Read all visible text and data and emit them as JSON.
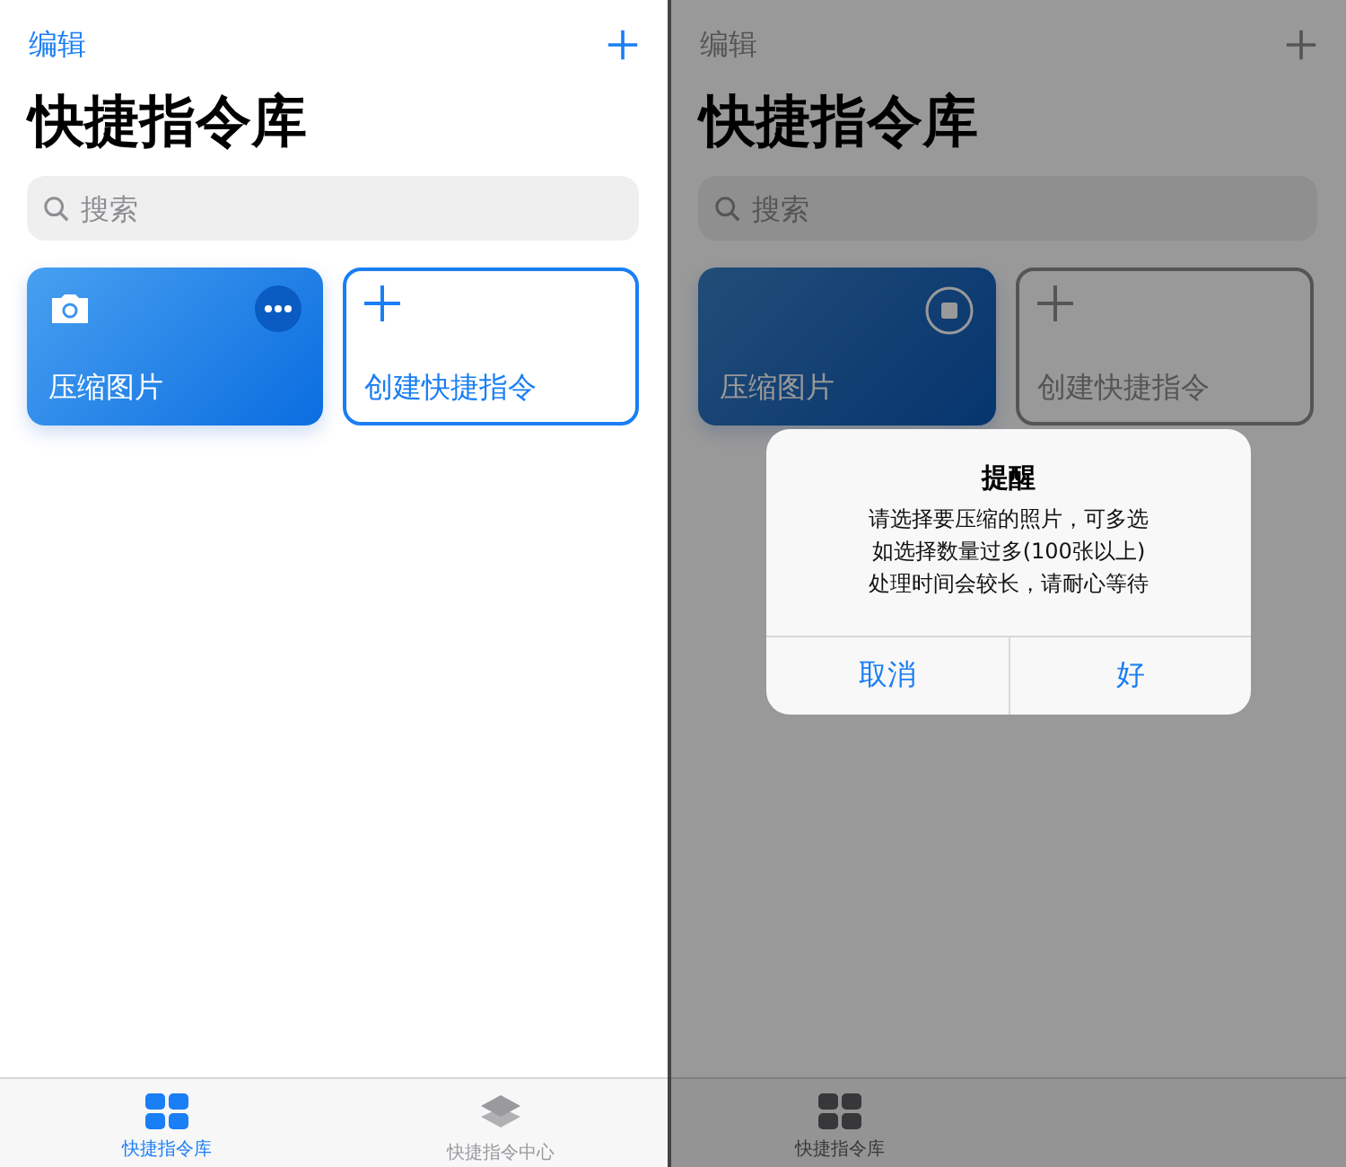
{
  "screens": [
    {
      "edit_label": "编辑",
      "title": "快捷指令库",
      "search": {
        "placeholder": "搜索"
      },
      "dimmed": false,
      "shortcuts": [
        {
          "kind": "shortcut",
          "label": "压缩图片",
          "running": false
        },
        {
          "kind": "create",
          "label": "创建快捷指令"
        }
      ],
      "tabs": [
        {
          "label": "快捷指令库",
          "selected": true
        },
        {
          "label": "快捷指令中心",
          "selected": false
        }
      ]
    },
    {
      "edit_label": "编辑",
      "title": "快捷指令库",
      "search": {
        "placeholder": "搜索"
      },
      "dimmed": true,
      "shortcuts": [
        {
          "kind": "shortcut",
          "label": "压缩图片",
          "running": true
        },
        {
          "kind": "create",
          "label": "创建快捷指令"
        }
      ],
      "tabs": [
        {
          "label": "快捷指令库",
          "selected": true
        }
      ],
      "alert": {
        "title": "提醒",
        "message_lines": [
          "请选择要压缩的照片，可多选",
          "如选择数量过多(100张以上)",
          "处理时间会较长，请耐心等待"
        ],
        "buttons": [
          "取消",
          "好"
        ]
      }
    }
  ]
}
